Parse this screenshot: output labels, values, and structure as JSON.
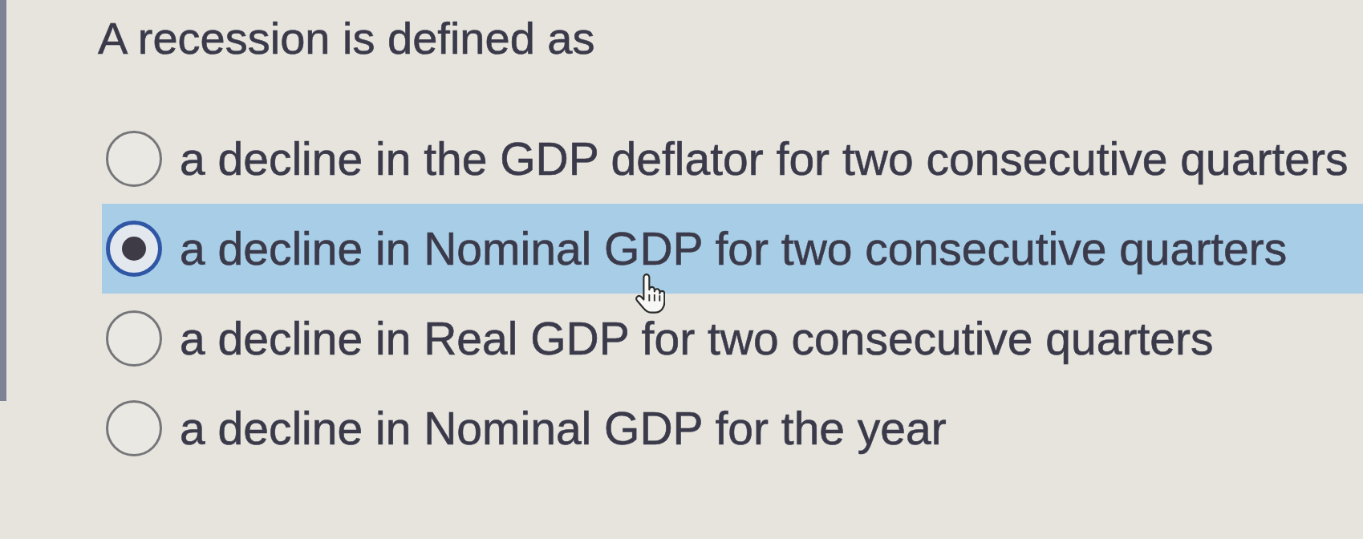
{
  "question": {
    "text": "A recession is defined as"
  },
  "options": [
    {
      "label": "a decline in the GDP deflator for two consecutive quarters",
      "selected": false
    },
    {
      "label": "a decline in Nominal GDP for two consecutive quarters",
      "selected": true
    },
    {
      "label": "a decline in Real GDP for two consecutive quarters",
      "selected": false
    },
    {
      "label": "a decline in Nominal GDP for the year",
      "selected": false
    }
  ]
}
